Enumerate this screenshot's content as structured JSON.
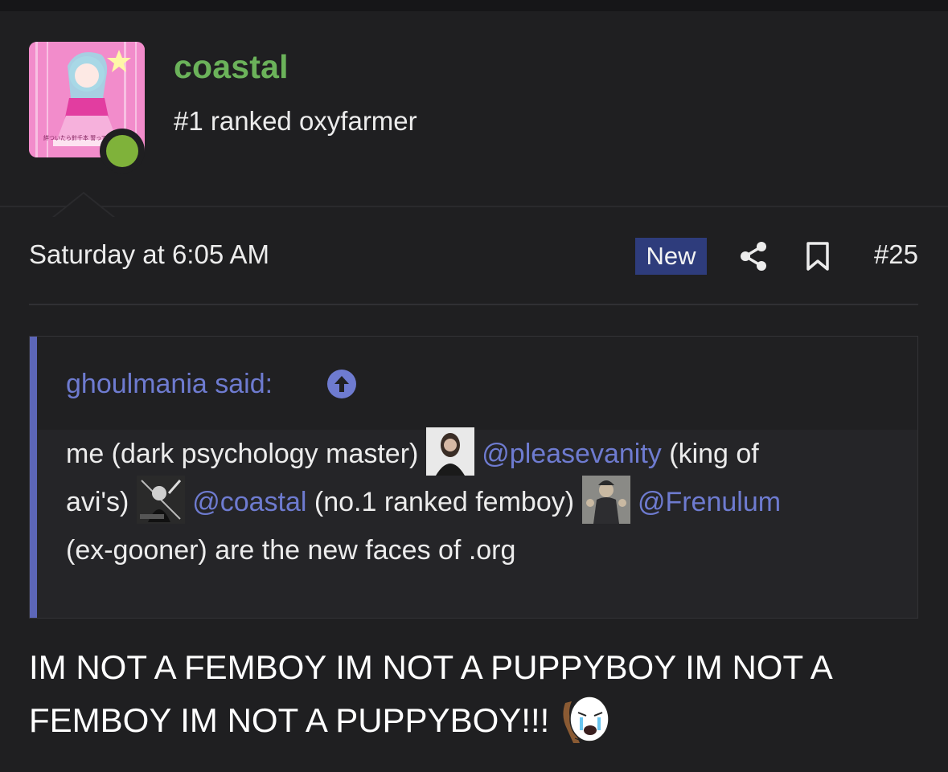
{
  "author": {
    "username": "coastal",
    "title": "#1 ranked oxyfarmer",
    "avatar_caption": "絆ついたら針千本 誓って",
    "online": true,
    "colors": {
      "username": "#6bb25a",
      "presence": "#7fb23a"
    }
  },
  "post": {
    "timestamp": "Saturday at 6:05 AM",
    "badge": "New",
    "number": "#25",
    "icons": [
      "share-icon",
      "bookmark-icon"
    ]
  },
  "quote": {
    "author_label": "ghoulmania said:",
    "icon": "arrow-up-circle-icon",
    "line1_text1": "me (dark psychology master) ",
    "mention1": "@pleasevanity",
    "line1_text2": " (king of",
    "line2_text1": "avi's) ",
    "mention2": "@coastal",
    "line2_text2": " (no.1 ranked femboy) ",
    "mention3": "@Frenulum",
    "line3_text": "(ex-gooner) are the new faces of .org"
  },
  "reply": {
    "line1": "IM NOT A FEMBOY IM NOT A PUPPYBOY IM NOT A",
    "line2": "FEMBOY IM NOT A PUPPYBOY!!!",
    "emoji": "crying-wojak-emoji"
  },
  "colors": {
    "background": "#1f1f21",
    "accent": "#5c66b8",
    "link": "#6e7bd0",
    "badge": "#2e3c7c"
  }
}
